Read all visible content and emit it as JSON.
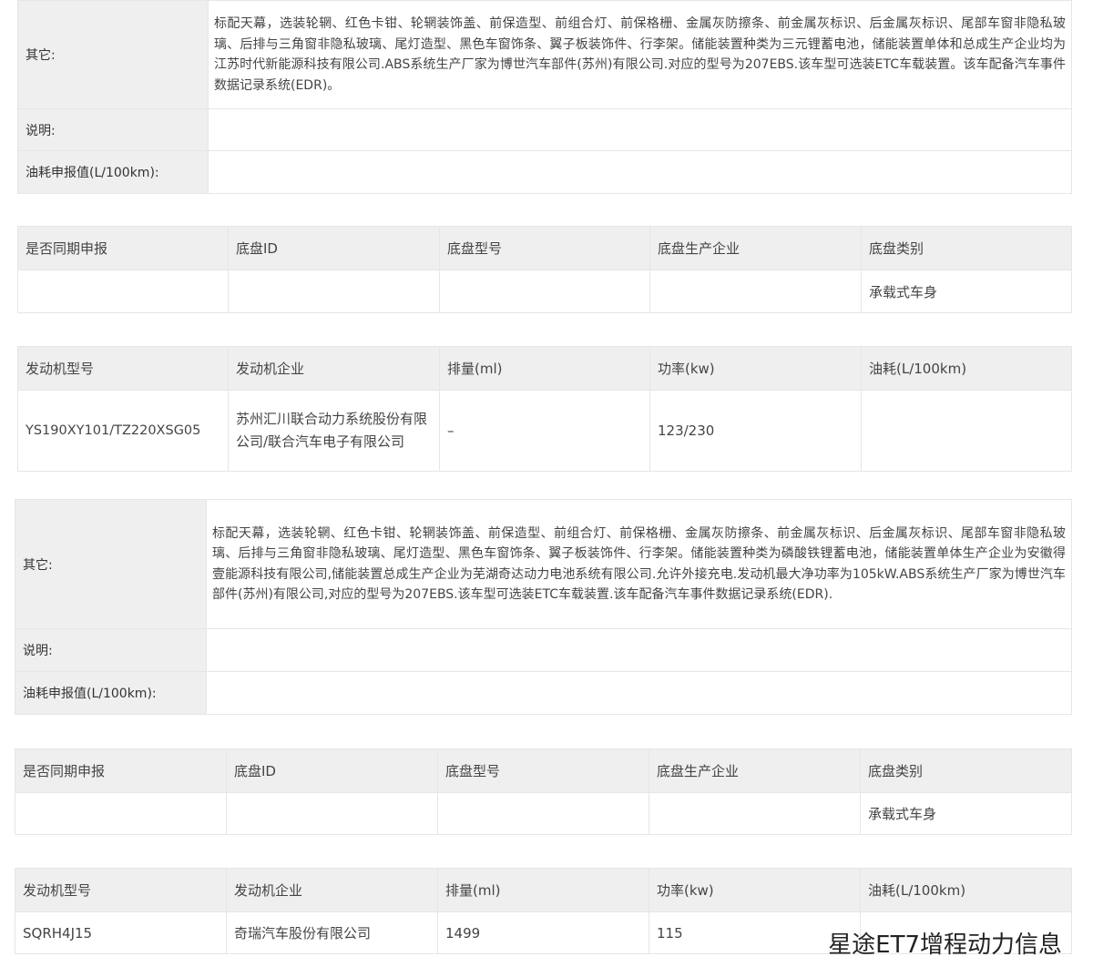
{
  "blocks": [
    {
      "other": {
        "label": "其它:",
        "text": "标配天幕，选装轮辋、红色卡钳、轮辋装饰盖、前保造型、前组合灯、前保格栅、金属灰防擦条、前金属灰标识、后金属灰标识、尾部车窗非隐私玻璃、后排与三角窗非隐私玻璃、尾灯造型、黑色车窗饰条、翼子板装饰件、行李架。储能装置种类为三元锂蓄电池，储能装置单体和总成生产企业均为江苏时代新能源科技有限公司.ABS系统生产厂家为博世汽车部件(苏州)有限公司.对应的型号为207EBS.该车型可选装ETC车载装置。该车配备汽车事件数据记录系统(EDR)。"
      },
      "note_label": "说明:",
      "fuel_label": "油耗申报值(L/100km):",
      "chassis": {
        "headers": [
          "是否同期申报",
          "底盘ID",
          "底盘型号",
          "底盘生产企业",
          "底盘类别"
        ],
        "values": [
          "",
          "",
          "",
          "",
          "承载式车身"
        ]
      },
      "engine": {
        "headers": [
          "发动机型号",
          "发动机企业",
          "排量(ml)",
          "功率(kw)",
          "油耗(L/100km)"
        ],
        "values": [
          "YS190XY101/TZ220XSG05",
          "苏州汇川联合动力系统股份有限公司/联合汽车电子有限公司",
          "–",
          "123/230",
          ""
        ]
      }
    },
    {
      "other": {
        "label": "其它:",
        "text": "标配天幕，选装轮辋、红色卡钳、轮辋装饰盖、前保造型、前组合灯、前保格栅、金属灰防擦条、前金属灰标识、后金属灰标识、尾部车窗非隐私玻璃、后排与三角窗非隐私玻璃、尾灯造型、黑色车窗饰条、翼子板装饰件、行李架。储能装置种类为磷酸铁锂蓄电池，储能装置单体生产企业为安徽得壹能源科技有限公司,储能装置总成生产企业为芜湖奇达动力电池系统有限公司.允许外接充电.发动机最大净功率为105kW.ABS系统生产厂家为博世汽车部件(苏州)有限公司,对应的型号为207EBS.该车型可选装ETC车载装置.该车配备汽车事件数据记录系统(EDR)."
      },
      "note_label": "说明:",
      "fuel_label": "油耗申报值(L/100km):",
      "chassis": {
        "headers": [
          "是否同期申报",
          "底盘ID",
          "底盘型号",
          "底盘生产企业",
          "底盘类别"
        ],
        "values": [
          "",
          "",
          "",
          "",
          "承载式车身"
        ]
      },
      "engine": {
        "headers": [
          "发动机型号",
          "发动机企业",
          "排量(ml)",
          "功率(kw)",
          "油耗(L/100km)"
        ],
        "values": [
          "SQRH4J15",
          "奇瑞汽车股份有限公司",
          "1499",
          "115",
          ""
        ]
      }
    }
  ],
  "watermark": "星途ET7增程动力信息"
}
